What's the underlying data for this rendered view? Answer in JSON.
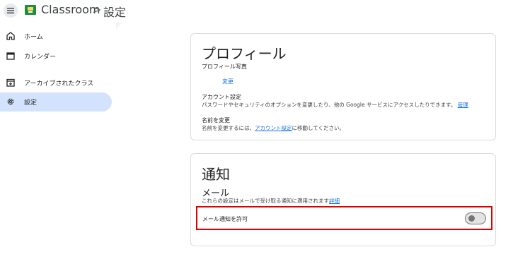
{
  "header": {
    "app_name": "Classroom",
    "separator": ">",
    "page": "設定"
  },
  "sidebar": {
    "items": [
      {
        "label": "ホーム",
        "icon": "home-icon"
      },
      {
        "label": "カレンダー",
        "icon": "calendar-icon"
      },
      {
        "label": "アーカイブされたクラス",
        "icon": "archive-icon"
      },
      {
        "label": "設定",
        "icon": "gear-icon",
        "active": true
      }
    ]
  },
  "profile": {
    "title": "プロフィール",
    "photo_label": "プロフィール写真",
    "change_link": "変更",
    "account_title": "アカウント設定",
    "account_desc": "パスワードやセキュリティのオプションを変更したり、他の Google サービスにアクセスしたりできます。",
    "account_link": "管理",
    "name_title": "名前を変更",
    "name_desc_pre": "名前を変更するには、",
    "name_desc_link": "アカウント設定",
    "name_desc_post": "に移動してください。"
  },
  "notifications": {
    "title": "通知",
    "email_title": "メール",
    "email_desc": "これらの設定はメールで受け取る通知に適用されます",
    "details_link": "詳細",
    "allow_label": "メール通知を許可",
    "allow_enabled": false
  },
  "colors": {
    "accent": "#1a73e8",
    "active_nav": "#d3e3fd",
    "highlight_border": "#e00000"
  }
}
